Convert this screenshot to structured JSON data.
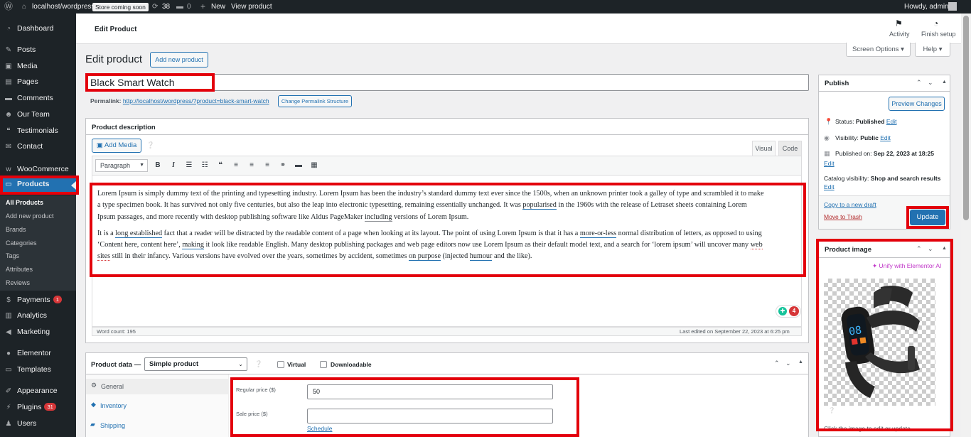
{
  "adminbar": {
    "site_name": "localhost/wordpress",
    "store_badge": "Store coming soon",
    "updates_count": "38",
    "comments_count": "0",
    "new_label": "New",
    "view_product": "View product",
    "howdy": "Howdy, admin"
  },
  "sidebar": {
    "items": [
      {
        "label": "Dashboard",
        "icon": "dashboard-icon"
      },
      {
        "label": "Posts",
        "icon": "pin-icon"
      },
      {
        "label": "Media",
        "icon": "media-icon"
      },
      {
        "label": "Pages",
        "icon": "pages-icon"
      },
      {
        "label": "Comments",
        "icon": "comment-icon"
      },
      {
        "label": "Our Team",
        "icon": "team-icon"
      },
      {
        "label": "Testimonials",
        "icon": "quote-icon"
      },
      {
        "label": "Contact",
        "icon": "mail-icon"
      },
      {
        "label": "WooCommerce",
        "icon": "woo-icon"
      },
      {
        "label": "Products",
        "icon": "archive-icon"
      },
      {
        "label": "Payments",
        "icon": "dollar-icon",
        "count": "1"
      },
      {
        "label": "Analytics",
        "icon": "chart-icon"
      },
      {
        "label": "Marketing",
        "icon": "megaphone-icon"
      },
      {
        "label": "Elementor",
        "icon": "elementor-icon"
      },
      {
        "label": "Templates",
        "icon": "folder-icon"
      },
      {
        "label": "Appearance",
        "icon": "brush-icon"
      },
      {
        "label": "Plugins",
        "icon": "plugin-icon",
        "count": "31"
      },
      {
        "label": "Users",
        "icon": "user-icon"
      }
    ],
    "submenu": [
      "All Products",
      "Add new product",
      "Brands",
      "Categories",
      "Tags",
      "Attributes",
      "Reviews"
    ]
  },
  "header": {
    "title": "Edit Product",
    "activity": "Activity",
    "finish_setup": "Finish setup",
    "screen_options": "Screen Options ▾",
    "help": "Help ▾"
  },
  "page": {
    "heading": "Edit product",
    "add_new": "Add new product",
    "product_title": "Black Smart Watch",
    "permalink_label": "Permalink:",
    "permalink_url": "http://localhost/wordpress/?product=black-smart-watch",
    "change_permalink": "Change Permalink Structure"
  },
  "description": {
    "heading": "Product description",
    "add_media": "Add Media",
    "tab_visual": "Visual",
    "tab_code": "Code",
    "format_select": "Paragraph",
    "p1_a": "Lorem Ipsum is simply dummy text of the printing and typesetting industry. Lorem Ipsum has been the industry’s standard dummy text ever since the 1500s, when an unknown printer took a galley of type and scrambled it to make",
    "p1_b": "a type specimen book. It has survived not only five centuries, but also the leap into electronic typesetting, remaining essentially unchanged. It was",
    "p1_b_u": "popularised",
    "p1_b2": "in the 1960s with the release of Letraset sheets containing Lorem",
    "p1_c": "Ipsum passages, and more recently with desktop publishing software like Aldus PageMaker",
    "p1_c_u": "including",
    "p1_c2": "versions of Lorem Ipsum.",
    "p2_a1": "It is a",
    "p2_a_u": "long established",
    "p2_a2": "fact that a reader will be distracted by the readable content of a page when looking at its layout. The point of using Lorem Ipsum is that it has a",
    "p2_a_u2": "more-or-less",
    "p2_a3": "normal distribution of letters, as opposed to using",
    "p2_b1": "‘Content here, content here’,",
    "p2_b_u": "making",
    "p2_b2": "it look like readable English. Many desktop publishing packages and web page editors now use Lorem Ipsum as their default model text, and a search for ‘lorem ipsum’ will uncover many",
    "p2_b_u2": "web",
    "p2_c_u": "sites",
    "p2_c1": "still in their infancy. Various versions have evolved over the years, sometimes by accident, sometimes",
    "p2_c_u2": "on purpose",
    "p2_c2": "(injected",
    "p2_c_u3": "humour",
    "p2_c3": "and the like).",
    "grammar_count": "4",
    "word_count": "Word count: 195",
    "last_edited": "Last edited on September 22, 2023 at 6:25 pm"
  },
  "product_data": {
    "heading": "Product data —",
    "type": "Simple product",
    "virtual": "Virtual",
    "downloadable": "Downloadable",
    "tabs": [
      "General",
      "Inventory",
      "Shipping"
    ],
    "regular_price_label": "Regular price ($)",
    "regular_price": "50",
    "sale_price_label": "Sale price ($)",
    "sale_price": "",
    "schedule": "Schedule"
  },
  "publish": {
    "heading": "Publish",
    "preview": "Preview Changes",
    "status_label": "Status:",
    "status_value": "Published",
    "visibility_label": "Visibility:",
    "visibility_value": "Public",
    "published_label": "Published on:",
    "published_value": "Sep 22, 2023 at 18:25",
    "catalog_label": "Catalog visibility:",
    "catalog_value": "Shop and search results",
    "edit": "Edit",
    "copy_draft": "Copy to a new draft",
    "trash": "Move to Trash",
    "update": "Update"
  },
  "product_image": {
    "heading": "Product image",
    "unify": "Unify with Elementor AI",
    "display_value": "08",
    "hint": "Click the image to edit or update"
  },
  "colors": {
    "accent": "#2271b1",
    "highlight": "#e3000b",
    "sidebar": "#1d2327"
  }
}
